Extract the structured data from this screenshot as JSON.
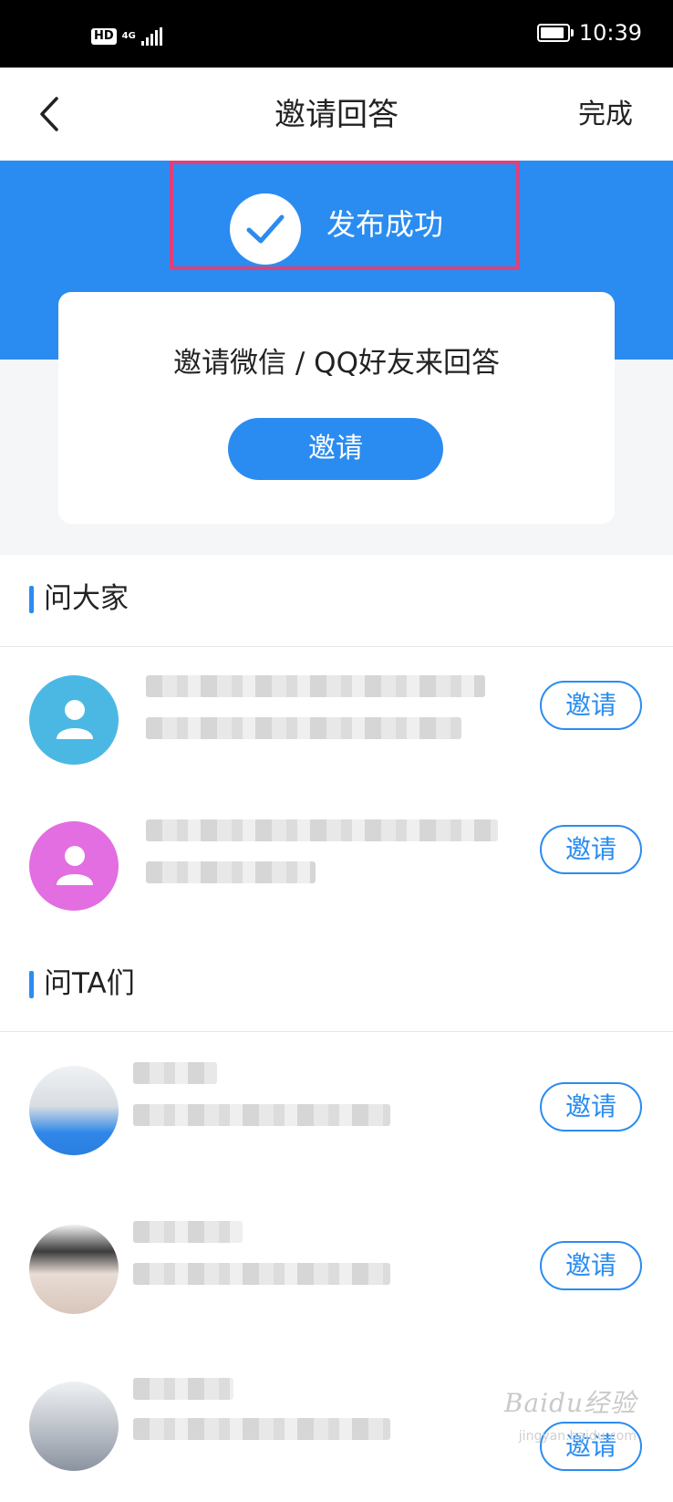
{
  "status_bar": {
    "time": "10:39",
    "hd": "HD",
    "network": "4G"
  },
  "navbar": {
    "title": "邀请回答",
    "done_label": "完成"
  },
  "banner": {
    "success_text": "发布成功"
  },
  "invite_card": {
    "text": "邀请微信 / QQ好友来回答",
    "button_label": "邀请"
  },
  "sections": [
    {
      "title": "问大家"
    },
    {
      "title": "问TA们"
    }
  ],
  "ask_all_users": [
    {
      "avatar": "person-icon",
      "avatar_color": "#4bb8e4",
      "button_label": "邀请"
    },
    {
      "avatar": "person-icon",
      "avatar_color": "#e26ee2",
      "button_label": "邀请"
    }
  ],
  "ask_ta_users": [
    {
      "button_label": "邀请"
    },
    {
      "button_label": "邀请"
    },
    {
      "button_label": "邀请"
    }
  ],
  "colors": {
    "accent": "#2a8cf0",
    "highlight_border": "#e0407a"
  },
  "watermark": {
    "text": "Baidu经验",
    "sub": "jingyan.baidu.com"
  }
}
